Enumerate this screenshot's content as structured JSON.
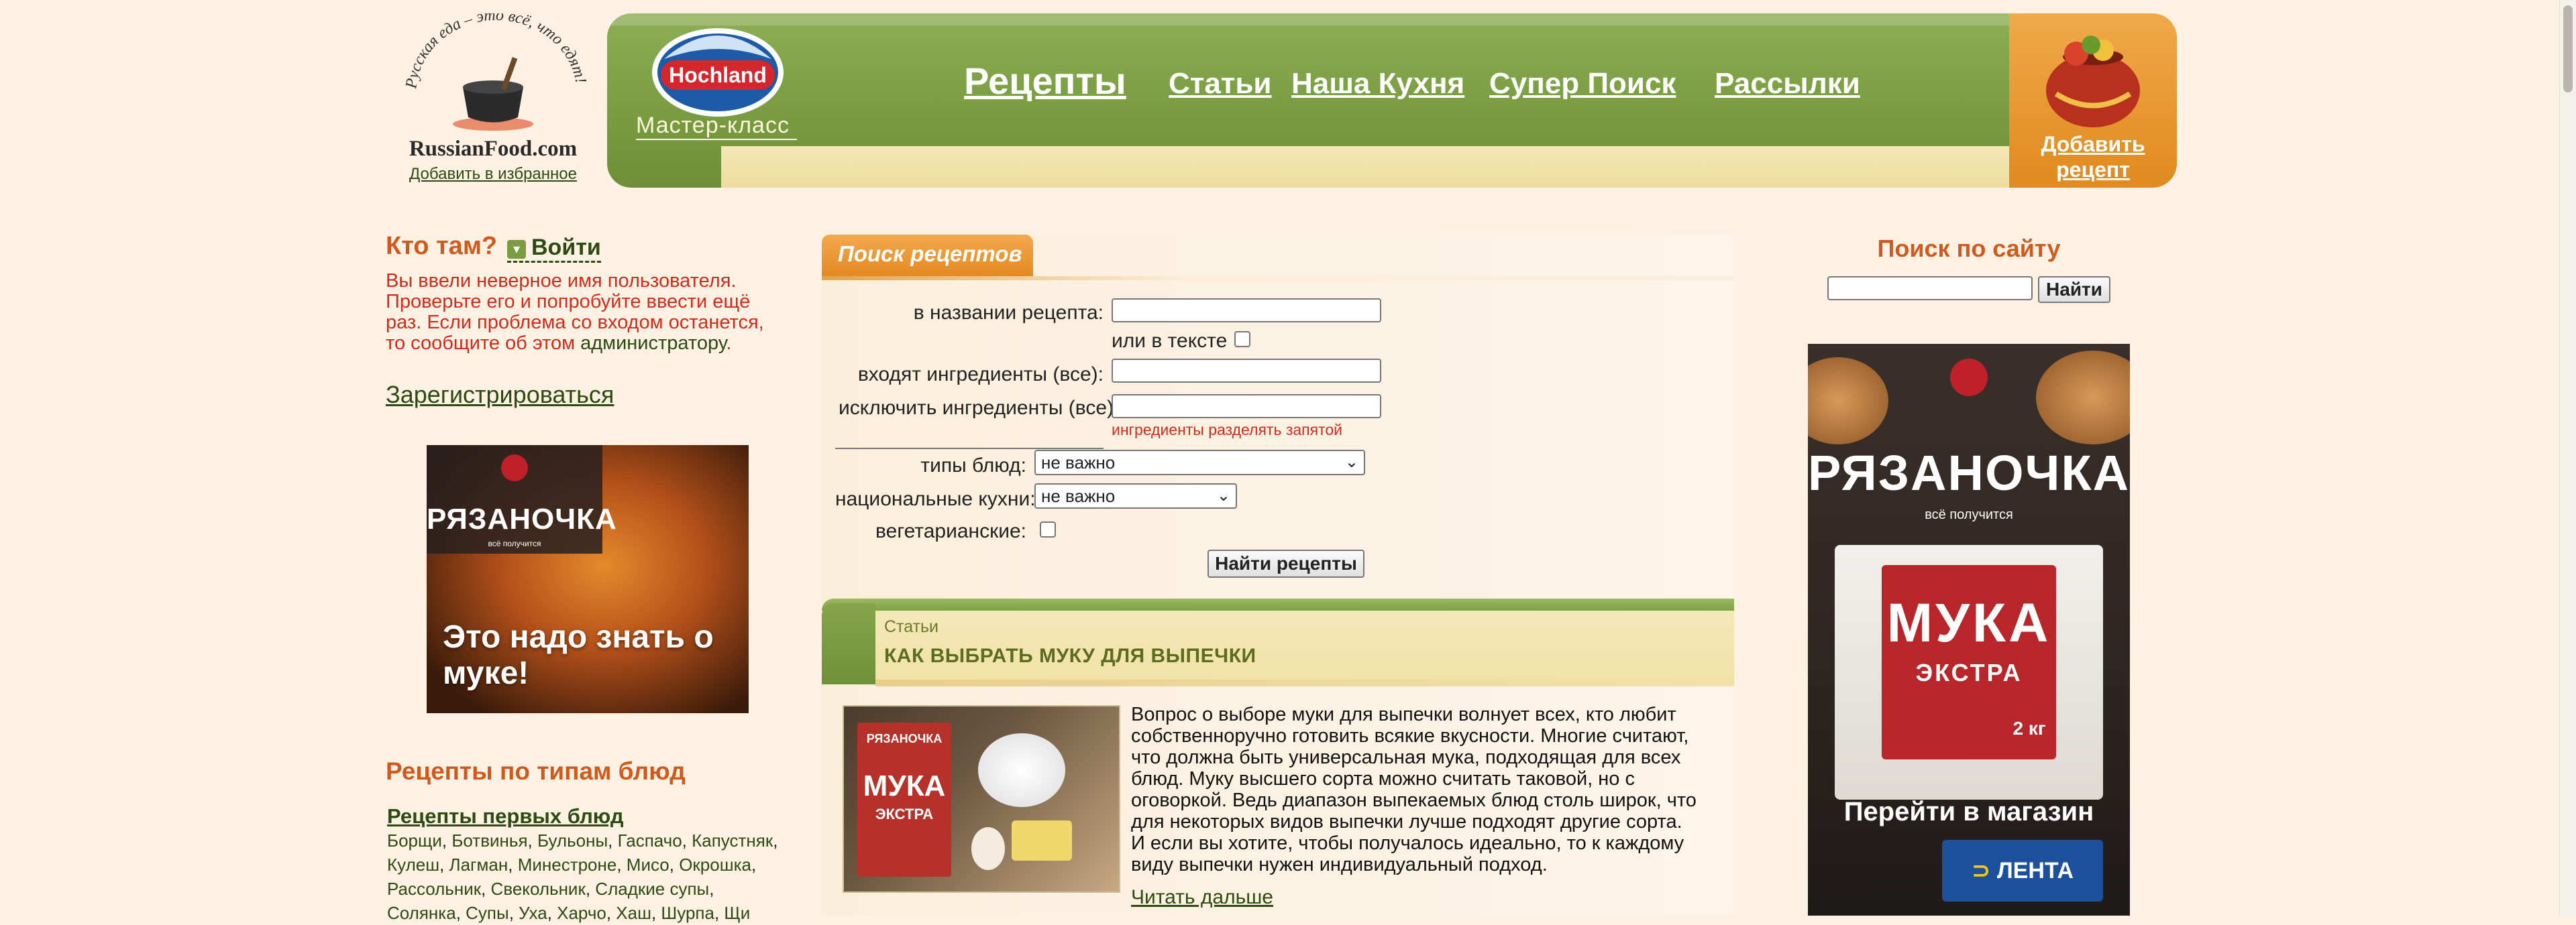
{
  "header": {
    "logo_tagline": "Русская еда – это всё, что едят!",
    "logo_text": "RussianFood.com",
    "favorite_link": "Добавить в избранное",
    "hochland_brand": "Hochland",
    "hochland_sub": "Мастер-класс",
    "nav": {
      "recipes": "Рецепты",
      "articles": "Статьи",
      "kitchen": "Наша Кухня",
      "super_search": "Супер Поиск",
      "mailings": "Рассылки"
    },
    "add_recipe": "Добавить рецепт"
  },
  "left": {
    "who_title": "Кто там?",
    "login_button": "Войти",
    "login_error_text": "Вы ввели неверное имя пользователя. Проверьте его и попробуйте ввести ещё раз. Если проблема со входом останется, то сообщите об этом",
    "login_error_link": "администратору",
    "register_link": "Зарегистрироваться",
    "ad": {
      "brand": "РЯЗАНОЧКА",
      "brand_sub": "всё получится",
      "headline": "Это надо знать о муке!"
    },
    "types_title": "Рецепты по типам блюд",
    "first_courses": "Рецепты первых блюд",
    "soups": [
      "Борщи",
      "Ботвинья",
      "Бульоны",
      "Гаспачо",
      "Капустняк",
      "Кулеш",
      "Лагман",
      "Минестроне",
      "Мисо",
      "Окрошка",
      "Рассольник",
      "Свекольник",
      "Сладкие супы",
      "Солянка",
      "Супы",
      "Уха",
      "Харчо",
      "Хаш",
      "Шурпа",
      "Щи"
    ]
  },
  "search": {
    "tab_label": "Поиск рецептов",
    "title_label": "в названии рецепта:",
    "in_text_label": "или в тексте",
    "include_label": "входят ингредиенты (все):",
    "exclude_label": "исключить ингредиенты (все):",
    "hint": "ингредиенты разделять запятой",
    "types_label": "типы блюд:",
    "types_value": "не важно",
    "cuisine_label": "национальные кухни:",
    "cuisine_value": "не важно",
    "veg_label": "вегетарианские:",
    "submit": "Найти рецепты"
  },
  "article": {
    "category": "Статьи",
    "title": "КАК ВЫБРАТЬ МУКУ ДЛЯ ВЫПЕЧКИ",
    "image_pack_brand": "РЯЗАНОЧКА",
    "image_pack_product": "МУКА",
    "image_pack_sub": "ЭКСТРА",
    "text": "Вопрос о выборе муки для выпечки волнует всех, кто любит собственноручно готовить всякие вкусности. Многие считают, что должна быть универсальная мука, подходящая для всех блюд. Муку высшего сорта можно считать таковой, но с оговоркой. Ведь диапазон выпекаемых блюд столь широк, что для некоторых видов выпечки лучше подходят другие сорта. И если вы хотите, чтобы получалось идеально, то к каждому виду выпечки нужен индивидуальный подход.",
    "read_more": "Читать дальше"
  },
  "right": {
    "site_search_title": "Поиск по сайту",
    "site_search_value": "",
    "site_search_button": "Найти",
    "ad": {
      "brand": "РЯЗАНОЧКА",
      "brand_sub": "всё получится",
      "product": "МУКА",
      "product_sub": "ЭКСТРА",
      "weight": "2 кг",
      "cta": "Перейти в магазин",
      "store": "ЛЕНТА"
    }
  },
  "colors": {
    "header_green": "#7a9d41",
    "header_orange": "#e38a22",
    "accent_orange": "#d05a1e",
    "error_red": "#d42a1a",
    "link_green": "#2d4a12",
    "page_bg": "#fdf1e4"
  }
}
